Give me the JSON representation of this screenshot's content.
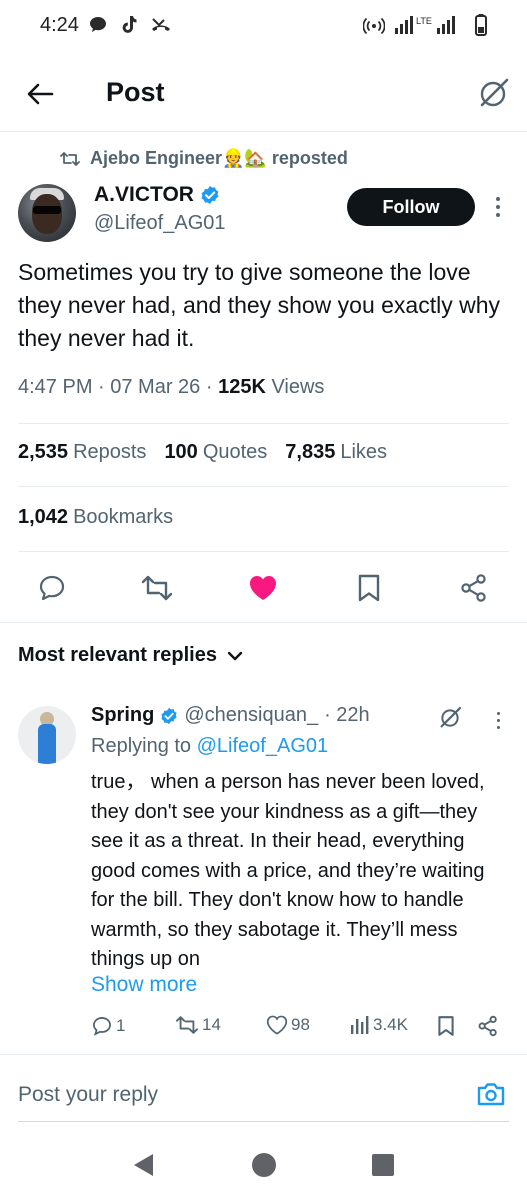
{
  "status_bar": {
    "time": "4:24",
    "network": "LTE"
  },
  "header": {
    "title": "Post"
  },
  "repost_banner": {
    "text": "Ajebo Engineer👷🏡 reposted"
  },
  "tweet": {
    "author_name": "A.VICTOR",
    "author_handle": "@Lifeof_AG01",
    "follow_label": "Follow",
    "text": "Sometimes you try to give someone the love they never had, and they show you exactly why they never had it.",
    "time_date": "4:47 PM · 07 Mar 26 · ",
    "views_count": "125K",
    "views_label": " Views"
  },
  "stats": {
    "reposts_count": "2,535",
    "reposts_label": "Reposts",
    "quotes_count": "100",
    "quotes_label": "Quotes",
    "likes_count": "7,835",
    "likes_label": "Likes",
    "bookmarks_count": "1,042",
    "bookmarks_label": "Bookmarks"
  },
  "colors": {
    "accent": "#1d9bf0",
    "like_active": "#f91880",
    "text_primary": "#0f1419",
    "text_secondary": "#536471",
    "verified": "#1d9bf0"
  },
  "replies": {
    "sort_label": "Most relevant replies",
    "items": [
      {
        "name": "Spring",
        "handle": "@chensiquan_",
        "time": "· 22h",
        "replying_prefix": "Replying to ",
        "replying_handle": "@Lifeof_AG01",
        "text": "true， when a person has never been loved, they don't see your kindness as a gift—they see it as a threat. In their head, everything good comes with a price, and they’re waiting for the bill. They don't know how to handle warmth, so they sabotage it. They’ll mess things up on",
        "show_more": "Show more",
        "reply_count": "1",
        "repost_count": "14",
        "like_count": "98",
        "view_count": "3.4K"
      }
    ]
  },
  "compose": {
    "placeholder": "Post your reply"
  },
  "icons": {
    "back": "arrow-left-icon",
    "grok": "grok-icon",
    "repost": "repost-icon",
    "verified": "verified-badge-icon",
    "reply": "comment-icon",
    "like": "heart-icon",
    "bookmark": "bookmark-icon",
    "share": "share-icon",
    "camera": "camera-icon",
    "views": "analytics-icon"
  }
}
